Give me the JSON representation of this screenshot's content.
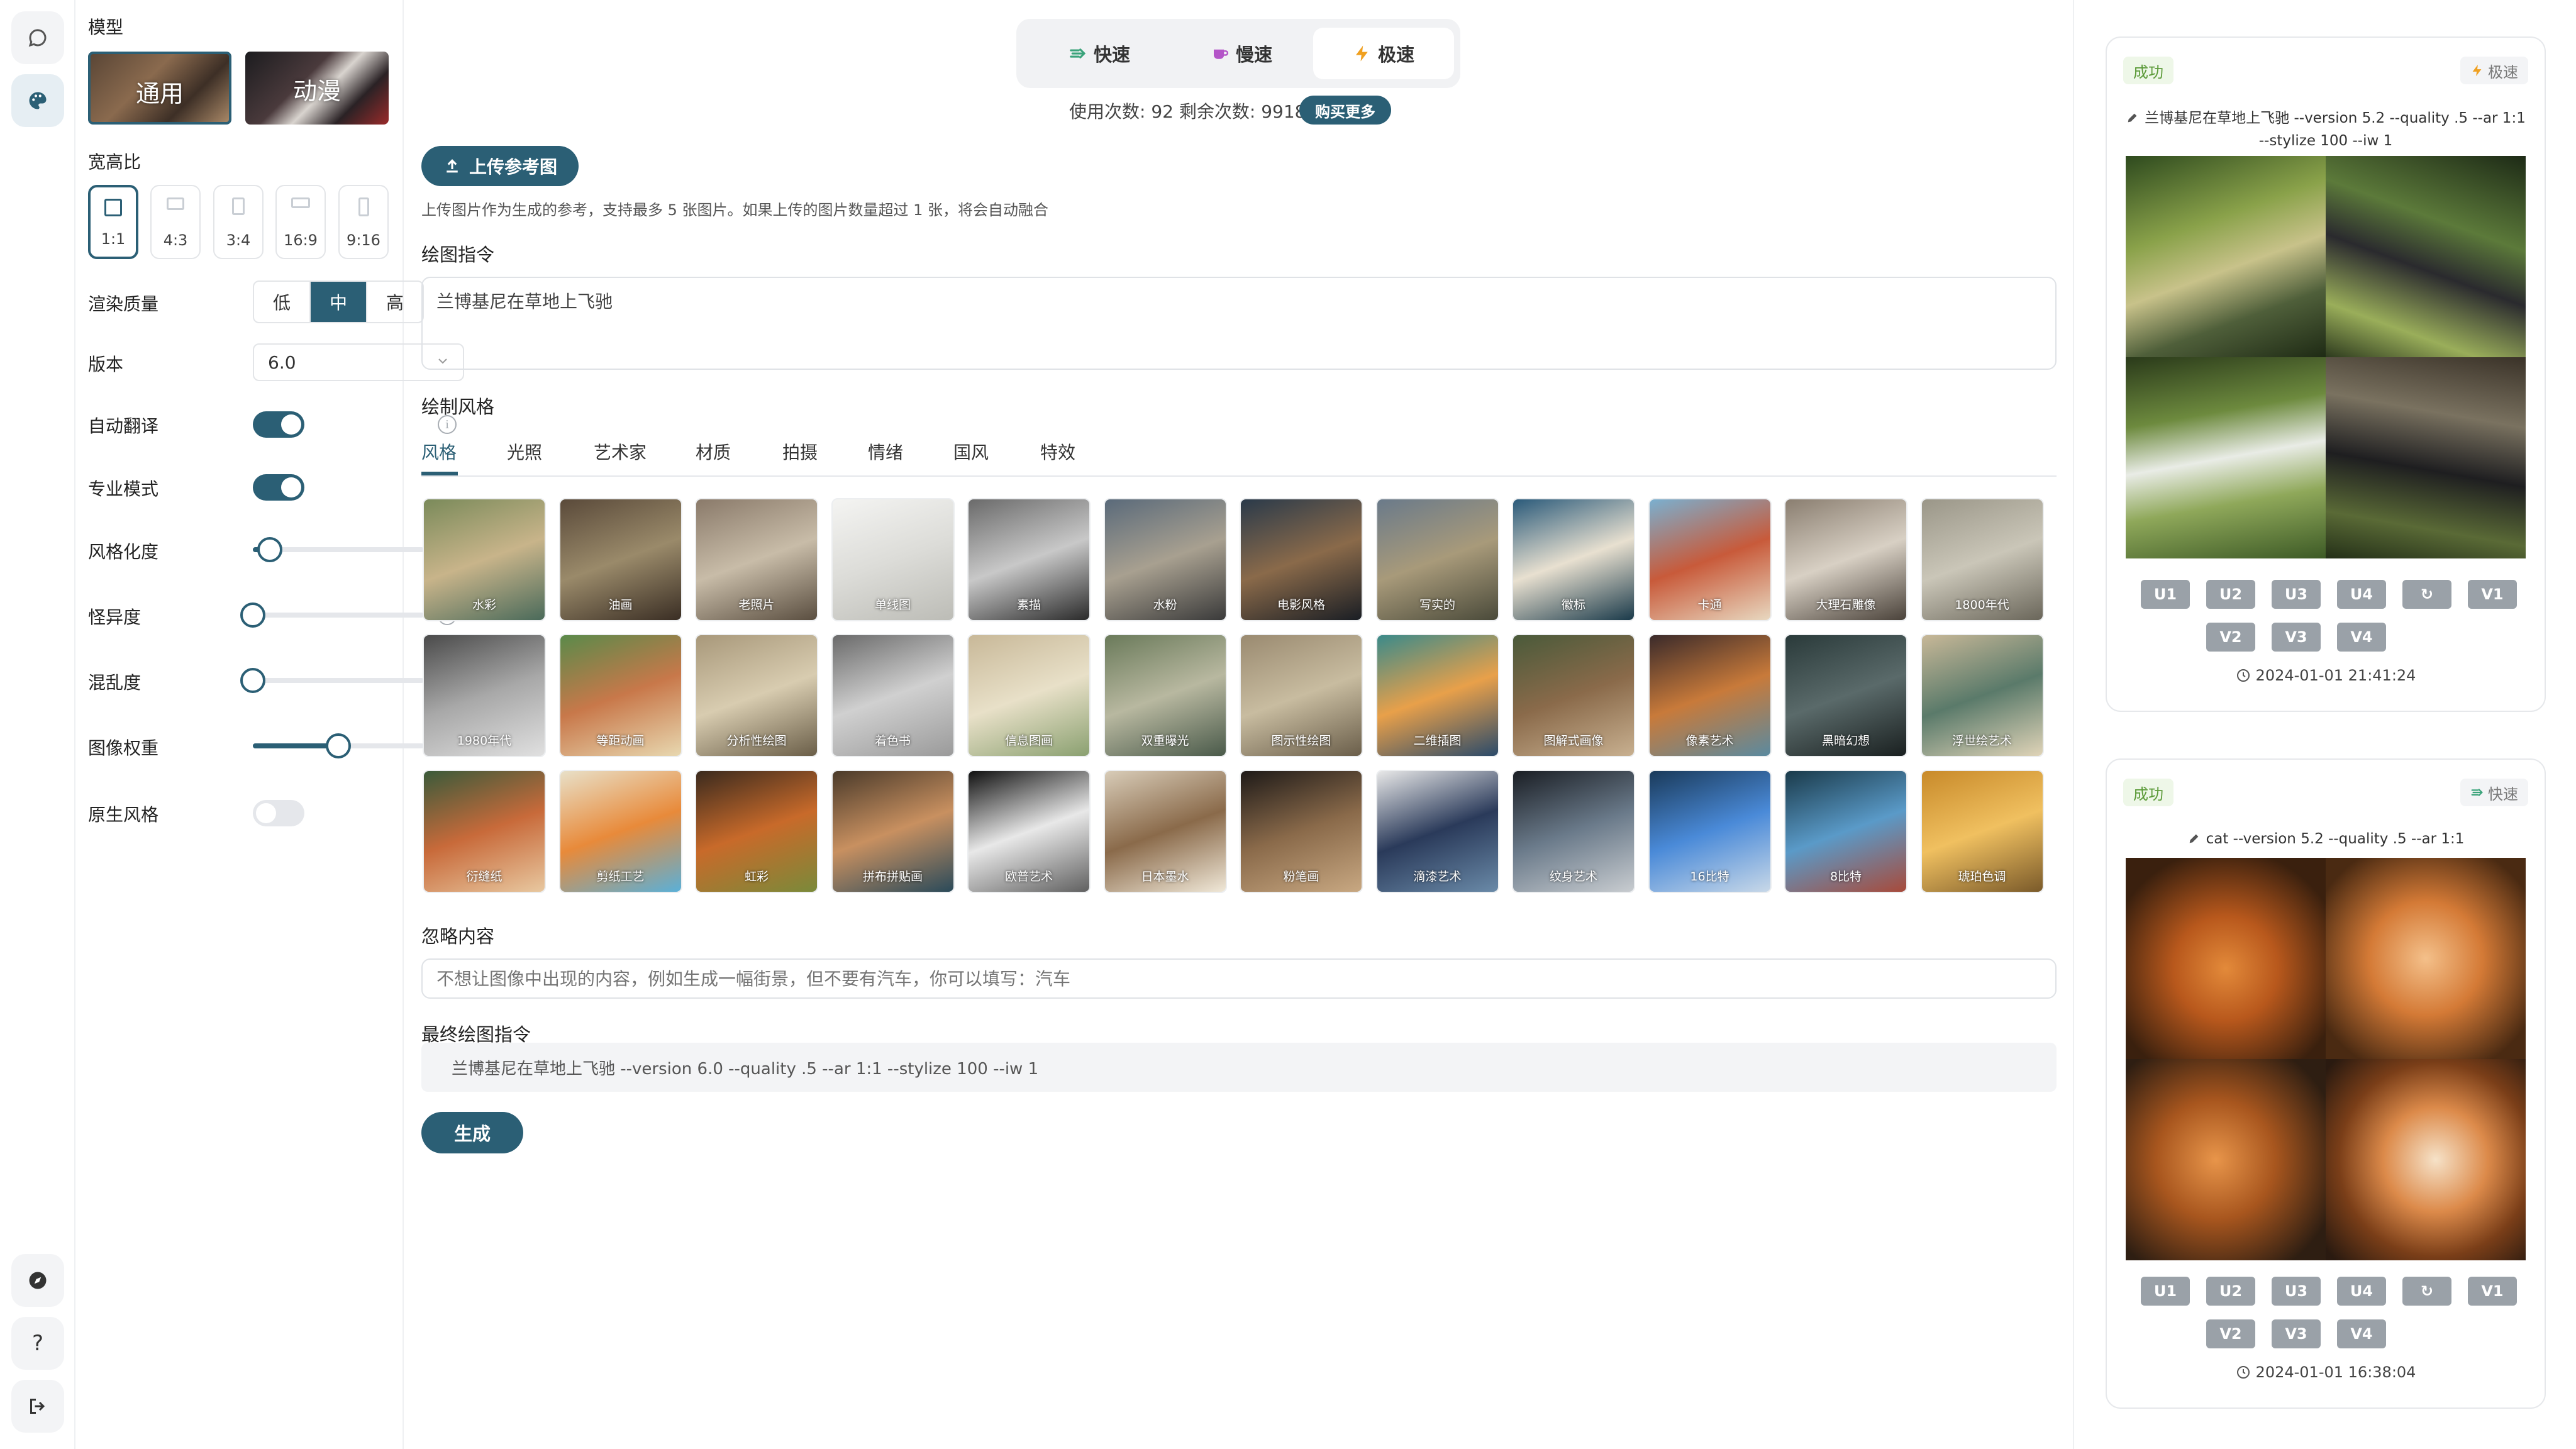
{
  "rail": {
    "icons": [
      "chat-icon",
      "palette-icon",
      "compass-icon",
      "help-icon",
      "logout-icon"
    ],
    "help_glyph": "?"
  },
  "settings": {
    "model_label": "模型",
    "models": [
      {
        "label": "通用",
        "selected": true
      },
      {
        "label": "动漫",
        "selected": false
      }
    ],
    "ratio_label": "宽高比",
    "ratios": [
      "1:1",
      "4:3",
      "3:4",
      "16:9",
      "9:16"
    ],
    "ratio_selected": "1:1",
    "quality_label": "渲染质量",
    "quality_options": [
      "低",
      "中",
      "高"
    ],
    "quality_selected": "中",
    "version_label": "版本",
    "version_value": "6.0",
    "auto_translate_label": "自动翻译",
    "pro_mode_label": "专业模式",
    "stylize_label": "风格化度",
    "weird_label": "怪异度",
    "chaos_label": "混乱度",
    "image_weight_label": "图像权重",
    "raw_style_label": "原生风格",
    "toggles": {
      "auto_translate": true,
      "pro_mode": true,
      "raw_style": false
    },
    "sliders": {
      "stylize": 0.1,
      "weird": 0.0,
      "chaos": 0.0,
      "image_weight": 0.5
    }
  },
  "main": {
    "speed_tabs": [
      {
        "label": "快速",
        "icon": "fast-icon"
      },
      {
        "label": "慢速",
        "icon": "cup-icon"
      },
      {
        "label": "极速",
        "icon": "bolt-icon"
      }
    ],
    "speed_selected": "极速",
    "usage_text": "使用次数: 92 剩余次数: 9918",
    "buy_label": "购买更多",
    "upload_label": "上传参考图",
    "upload_note": "上传图片作为生成的参考，支持最多 5 张图片。如果上传的图片数量超过 1 张，将会自动融合",
    "prompt_label": "绘图指令",
    "prompt_value": "兰博基尼在草地上飞驰",
    "style_label": "绘制风格",
    "style_tabs": [
      "风格",
      "光照",
      "艺术家",
      "材质",
      "拍摄",
      "情绪",
      "国风",
      "特效"
    ],
    "style_tab_selected": "风格",
    "styles": [
      "水彩",
      "油画",
      "老照片",
      "单线图",
      "素描",
      "水粉",
      "电影风格",
      "写实的",
      "徽标",
      "卡通",
      "大理石雕像",
      "1800年代",
      "1980年代",
      "等距动画",
      "分析性绘图",
      "着色书",
      "信息图画",
      "双重曝光",
      "图示性绘图",
      "二维插图",
      "图解式画像",
      "像素艺术",
      "黑暗幻想",
      "浮世绘艺术",
      "衍缝纸",
      "剪纸工艺",
      "虹彩",
      "拼布拼贴画",
      "欧普艺术",
      "日本墨水",
      "粉笔画",
      "滴漆艺术",
      "纹身艺术",
      "16比特",
      "8比特",
      "琥珀色调"
    ],
    "negative_label": "忽略内容",
    "negative_placeholder": "不想让图像中出现的内容，例如生成一幅街景，但不要有汽车，你可以填写：汽车",
    "final_label": "最终绘图指令",
    "final_value": "兰博基尼在草地上飞驰 --version 6.0 --quality .5 --ar 1:1 --stylize 100 --iw 1",
    "generate_label": "生成"
  },
  "history": [
    {
      "status": "成功",
      "mode": "极速",
      "prompt": "兰博基尼在草地上飞驰 --version 5.2 --quality .5 --ar 1:1 --stylize 100 --iw 1",
      "actions_row1": [
        "U1",
        "U2",
        "U3",
        "U4",
        "↻",
        "V1"
      ],
      "actions_row2": [
        "V2",
        "V3",
        "V4"
      ],
      "time": "2024-01-01 21:41:24",
      "images": [
        "car-image-1",
        "car-image-2",
        "car-image-3",
        "car-image-4"
      ]
    },
    {
      "status": "成功",
      "mode": "快速",
      "prompt": "cat --version 5.2 --quality .5 --ar 1:1",
      "actions_row1": [
        "U1",
        "U2",
        "U3",
        "U4",
        "↻",
        "V1"
      ],
      "actions_row2": [
        "V2",
        "V3",
        "V4"
      ],
      "time": "2024-01-01 16:38:04",
      "images": [
        "cat-image-1",
        "cat-image-2",
        "cat-image-3",
        "cat-image-4"
      ]
    }
  ],
  "colors": {
    "accent": "#2b5f75",
    "success": "#5b9a38"
  }
}
